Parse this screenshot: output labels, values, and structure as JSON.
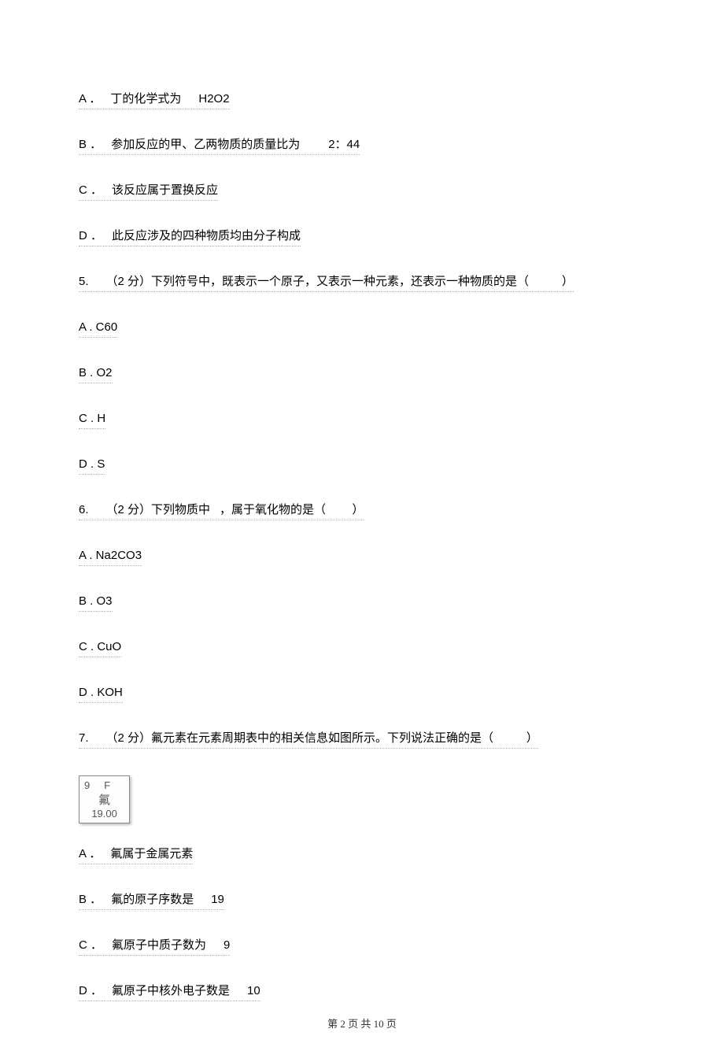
{
  "q4": {
    "A": {
      "letter": "A ．",
      "text": "丁的化学式为",
      "after": "H2O2"
    },
    "B": {
      "letter": "B ．",
      "text": "参加反应的甲、乙两物质的质量比为",
      "after": "2：44"
    },
    "C": {
      "letter": "C ．",
      "text": "该反应属于置换反应"
    },
    "D": {
      "letter": "D ．",
      "text": "此反应涉及的四种物质均由分子构成"
    }
  },
  "q5": {
    "stem": {
      "num": "5.",
      "pts": "（2 分）",
      "text": "下列符号中，既表示一个原子，又表示一种元素，还表示一种物质的是（",
      "blank": "          ",
      "close": "）"
    },
    "A": "A . C60",
    "B": "B . O2",
    "C": "C . H",
    "D": "D . S"
  },
  "q6": {
    "stem": {
      "num": "6.",
      "pts": "（2 分）",
      "text1": "下列物质中",
      "text2": "，属于氧化物的是（",
      "blank": "        ",
      "close": "）"
    },
    "A": "A . Na2CO3",
    "B": "B . O3",
    "C": "C . CuO",
    "D": "D . KOH"
  },
  "q7": {
    "stem": {
      "num": "7.",
      "pts": "（2 分）",
      "text": "氟元素在元素周期表中的相关信息如图所示。下列说法正确的是（",
      "blank": "          ",
      "close": "）"
    },
    "element": {
      "num": "9",
      "sym": "F",
      "name": "氟",
      "mass": "19.00"
    },
    "A": {
      "letter": "A ．",
      "text": "氟属于金属元素"
    },
    "B": {
      "letter": "B ．",
      "text": "氟的原子序数是",
      "after": "19"
    },
    "C": {
      "letter": "C ．",
      "text": "氟原子中质子数为",
      "after": "9"
    },
    "D": {
      "letter": "D ．",
      "text": "氟原子中核外电子数是",
      "after": "10"
    }
  },
  "footer": "第 2 页 共 10 页"
}
